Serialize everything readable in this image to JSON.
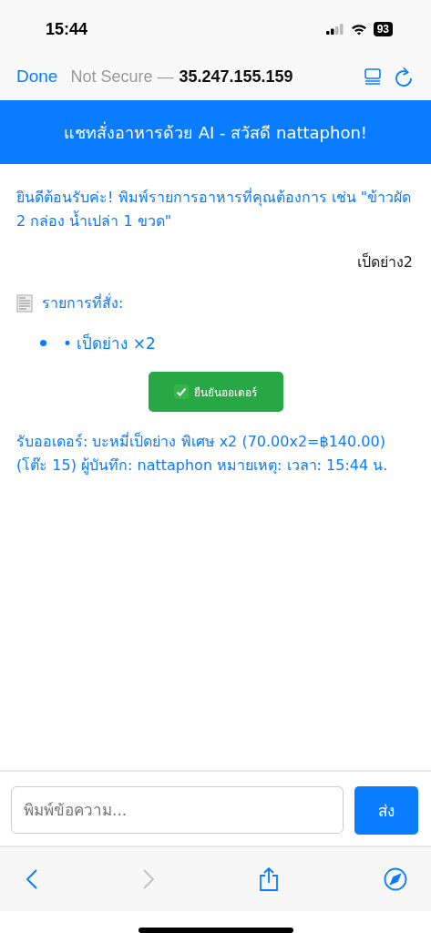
{
  "status_bar": {
    "time": "15:44",
    "battery": "93"
  },
  "browser_bar": {
    "done": "Done",
    "security": "Not Secure —",
    "host": "35.247.155.159"
  },
  "header": {
    "title": "แชทสั่งอาหารด้วย AI - สวัสดี nattaphon!"
  },
  "messages": [
    {
      "kind": "bot",
      "text": "ยินดีต้อนรับค่ะ! พิมพ์รายการอาหารที่คุณต้องการ เช่น \"ข้าวผัด 2 กล่อง น้ำเปล่า 1 ขวด\""
    },
    {
      "kind": "user",
      "text": "เป็ดย่าง2"
    },
    {
      "kind": "order",
      "title": "รายการที่สั่ง:",
      "items": [
        "• เป็ดย่าง ×2"
      ],
      "button": "ยืนยันออเดอร์"
    },
    {
      "kind": "bot",
      "text": "รับออเดอร์: บะหมี่เป็ดย่าง พิเศษ x2 (70.00x2=฿140.00) (โต๊ะ 15) ผู้บันทึก: nattaphon หมายเหตุ: เวลา: 15:44 น."
    }
  ],
  "composer": {
    "placeholder": "พิมพ์ข้อความ...",
    "send": "ส่ง"
  },
  "toolbar": {
    "back_disabled": false,
    "forward_disabled": true
  }
}
